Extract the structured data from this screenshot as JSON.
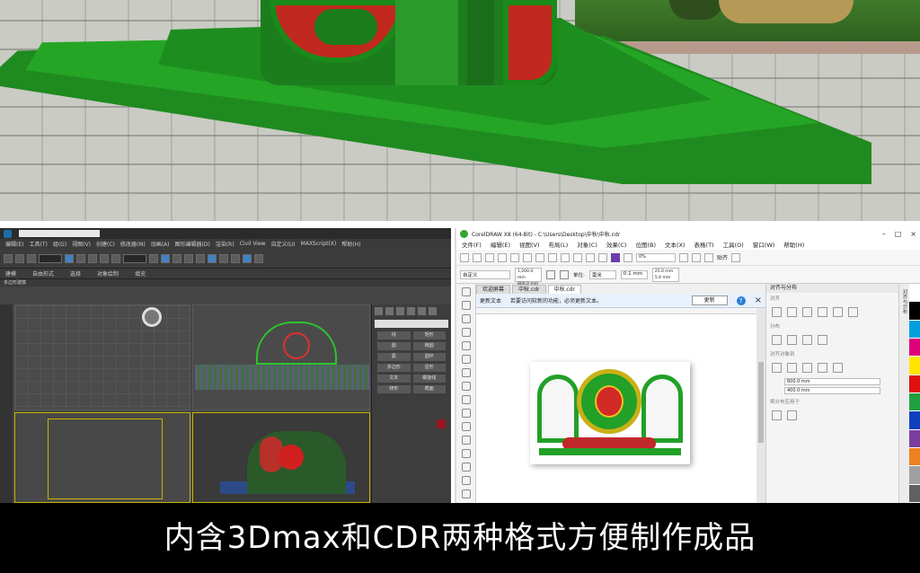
{
  "caption": "内含3Dmax和CDR两种格式方便制作成品",
  "max": {
    "search_text": "",
    "menus": [
      "编辑(E)",
      "工具(T)",
      "组(G)",
      "视图(V)",
      "创建(C)",
      "修改器(M)",
      "动画(A)",
      "图形编辑器(D)",
      "渲染(R)",
      "Civil View",
      "自定义(U)",
      "MAXScript(X)",
      "帮助(H)"
    ],
    "ribbon_tabs": [
      "建模",
      "自由形式",
      "选择",
      "对象绘制",
      "填充"
    ],
    "subtitle": "多边形建模",
    "cmd_buttons": [
      "线",
      "矩形",
      "圆",
      "椭圆",
      "弧",
      "圆环",
      "多边形",
      "星形",
      "文本",
      "螺旋线",
      "卵形",
      "截面"
    ]
  },
  "cdr": {
    "title": "CorelDRAW X8 (64-Bit) - C:\\Users\\Desktop\\中秋\\中秋.cdr",
    "menus": [
      "文件(F)",
      "编辑(E)",
      "视图(V)",
      "布局(L)",
      "对象(C)",
      "效果(C)",
      "位图(B)",
      "文本(X)",
      "表格(T)",
      "工具(O)",
      "窗口(W)",
      "帮助(H)"
    ],
    "zoom": "0%",
    "preset": "自定义",
    "width_field": "1,200.0 mm",
    "height_field": "800.0 mm",
    "unit_label": "单位:",
    "unit_value": "毫米",
    "nudge": "0.1 mm",
    "dup_x": "25.0 mm",
    "dup_y": "5.0 mm",
    "snap": "贴齐",
    "tabs": [
      "欢迎屏幕",
      "中秋.cdr",
      "中秋.cdr"
    ],
    "notice": "更新文本",
    "notice_msg": "若要访问较新的功能，必须更新文本。",
    "update_button": "更新",
    "dock_title": "对齐与分布",
    "dock_sec1": "对齐",
    "dock_sec2": "分布",
    "dock_sec3": "对齐对象到",
    "dock_val1": "600.0 mm",
    "dock_val2": "400.0 mm",
    "dock_sec4": "将分布应用于",
    "side_label": "对齐与分布",
    "palette": [
      "#ffffff",
      "#000000",
      "#00a0e0",
      "#e0007a",
      "#ffe600",
      "#e01010",
      "#20a040",
      "#1040c0",
      "#7a3ea0",
      "#f08020",
      "#a0a0a0",
      "#606060"
    ]
  }
}
